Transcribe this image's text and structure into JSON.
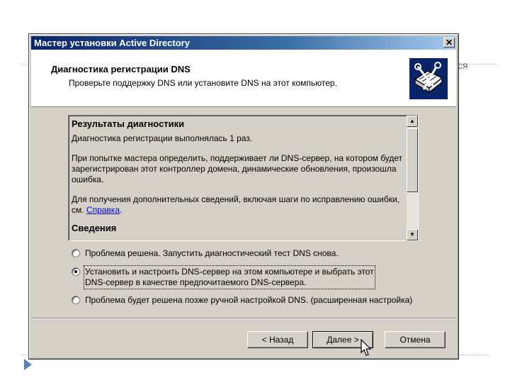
{
  "slide": {
    "fragment_text": "ся"
  },
  "window": {
    "title": "Мастер установки Active Directory",
    "close_label": "✕"
  },
  "header": {
    "title": "Диагностика регистрации DNS",
    "subtitle": "Проверьте поддержку DNS или установите DNS на этот компьютер.",
    "icon": "book-tools-icon"
  },
  "results": {
    "heading": "Результаты диагностики",
    "line1": "Диагностика регистрации выполнялась 1 раз.",
    "para2": "При попытке мастера определить, поддерживает ли DNS-сервер, на котором будет зарегистрирован этот контроллер домена, динамические обновления, произошла ошибка.",
    "para3_prefix": "Для получения дополнительных сведений, включая шаги по исправлению ошибки, см. ",
    "para3_link": "Справка",
    "para3_suffix": ".",
    "heading2": "Сведения",
    "scroll_up": "▲",
    "scroll_down": "▼"
  },
  "options": [
    {
      "label": "Проблема решена. Запустить диагностический тест DNS снова.",
      "checked": false
    },
    {
      "label_line1": "Установить и настроить DNS-сервер на этом компьютере и выбрать этот",
      "label_line2": "DNS-сервер в качестве предпочитаемого DNS-сервера.",
      "checked": true
    },
    {
      "label": "Проблема будет решена позже ручной настройкой DNS. (расширенная настройка)",
      "checked": false
    }
  ],
  "buttons": {
    "back": "< Назад",
    "next": "Далее >",
    "cancel": "Отмена"
  }
}
